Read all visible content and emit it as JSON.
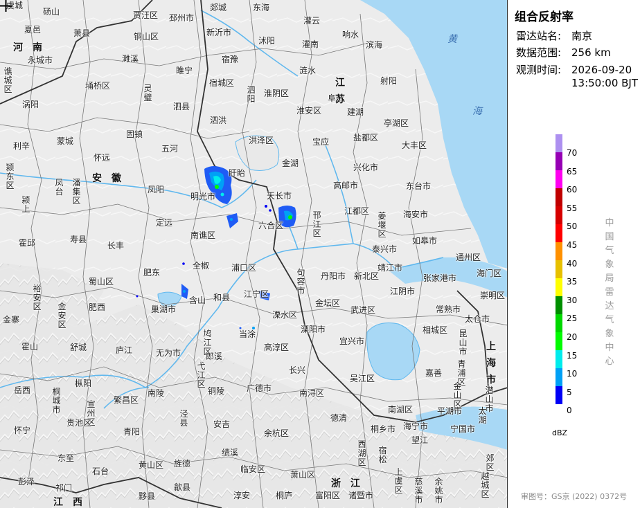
{
  "panel": {
    "title": "组合反射率",
    "station_label": "雷达站名:",
    "station": "南京",
    "range_label": "数据范围:",
    "range": "256 km",
    "time_label": "观测时间:",
    "time_date": "2026-09-20",
    "time_clock": "13:50:00 BJT",
    "unit": "dBZ",
    "source": "中国气象局雷达气象中心",
    "approval": "审图号：GS京 (2022) 0372号"
  },
  "legend": {
    "ticks": [
      "70",
      "65",
      "60",
      "55",
      "50",
      "45",
      "40",
      "35",
      "30",
      "25",
      "20",
      "15",
      "10",
      "5",
      "0"
    ],
    "colors": [
      "#ad90f0",
      "#9600b4",
      "#ff00f0",
      "#c00000",
      "#d60000",
      "#ff0000",
      "#ff9000",
      "#e7c000",
      "#ffff00",
      "#008f00",
      "#00d800",
      "#02fc02",
      "#00ecec",
      "#00a0f6",
      "#0000f6"
    ]
  },
  "map": {
    "colors": {
      "land": "#e9e9e9",
      "sea": "#a8d8f5",
      "river": "#60b8ee",
      "border": "#555555"
    },
    "station_marker": "crosshair-icon",
    "provinces": [
      "河南",
      "安徽",
      "江苏",
      "浙江",
      "上海市",
      "江西"
    ],
    "sea_label": "黄海",
    "places": [
      "虞城",
      "砀山",
      "郯城",
      "东海",
      "灌云",
      "夏邑",
      "萧县",
      "贾汪区",
      "邳州市",
      "新沂市",
      "沭阳",
      "灌南",
      "响水",
      "永城市",
      "铜山区",
      "宿豫",
      "滨海",
      "谯城区",
      "濉溪",
      "睢宁",
      "宿城区",
      "泗阳",
      "淮阴区",
      "涟水",
      "阜宁",
      "射阳",
      "涡阳",
      "埇桥区",
      "灵璧",
      "泗县",
      "淮安区",
      "建湖",
      "固镇",
      "泗洪",
      "亭湖区",
      "利辛",
      "蒙城",
      "怀远",
      "五河",
      "洪泽区",
      "宝应",
      "盐都区",
      "大丰区",
      "颍东区",
      "凤台",
      "潘集区",
      "盱眙",
      "金湖",
      "兴化市",
      "凤阳",
      "明光市",
      "天长市",
      "高邮市",
      "东台市",
      "颍上",
      "定远",
      "江都区",
      "海安市",
      "霍邱",
      "寿县",
      "长丰",
      "南谯区",
      "六合区",
      "邗江区",
      "姜堰区",
      "如皋市",
      "泰兴市",
      "靖江市",
      "肥东",
      "全椒",
      "浦口区",
      "通州区",
      "海门区",
      "裕安区",
      "蜀山区",
      "肥西",
      "和县",
      "江宁区",
      "句容市",
      "丹阳市",
      "新北区",
      "江阴市",
      "张家港市",
      "常熟市",
      "崇明区",
      "金寨",
      "金安区",
      "巢湖市",
      "含山",
      "溧水区",
      "金坛区",
      "武进区",
      "太仓市",
      "霍山",
      "舒城",
      "庐江",
      "无为市",
      "鸠江区",
      "当涂",
      "高淳区",
      "溧阳市",
      "宜兴市",
      "相城区",
      "昆山市",
      "青浦区",
      "岳西",
      "桐城市",
      "枞阳",
      "繁昌区",
      "弋江区",
      "郎溪",
      "长兴",
      "吴江区",
      "嘉善",
      "金山区",
      "潜山市",
      "宣州区",
      "广德市",
      "南浔区",
      "南湖区",
      "平湖市",
      "太湖",
      "怀宁",
      "贵池区",
      "青阳",
      "泾县",
      "安吉",
      "德清",
      "桐乡市",
      "海宁市",
      "宁国市",
      "余杭区",
      "西湖区",
      "望江",
      "东至",
      "石台",
      "黄山区",
      "旌德",
      "绩溪",
      "临安区",
      "萧山区",
      "宿松",
      "彭泽",
      "祁门",
      "黟县",
      "歙县",
      "淳安",
      "桐庐",
      "富阳区",
      "诸暨市",
      "上虞区",
      "余姚市",
      "越城区",
      "慈溪市",
      "郊区",
      "南陵",
      "铜陵"
    ]
  }
}
